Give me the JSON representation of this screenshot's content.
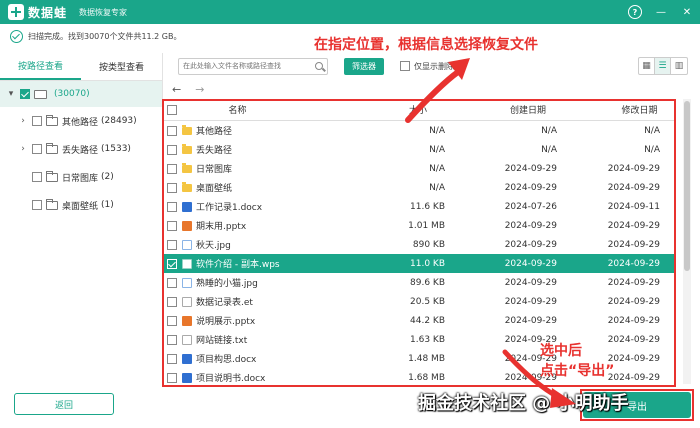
{
  "app": {
    "name": "数据蛙",
    "subtitle": "数据恢复专家",
    "help_symbol": "?",
    "minimize_symbol": "—",
    "close_symbol": "✕"
  },
  "status": {
    "text": "扫描完成。找到30070个文件共11.2 GB。"
  },
  "annotations": {
    "top": "在指定位置，根据信息选择恢复文件",
    "bottom_line1": "选中后",
    "bottom_line2": "点击“导出”"
  },
  "sidebar": {
    "tabs": [
      {
        "label": "按路径查看"
      },
      {
        "label": "按类型查看"
      }
    ],
    "root": {
      "count": "(30070)"
    },
    "items": [
      {
        "label": "其他路径",
        "count": "(28493)",
        "expandable": true
      },
      {
        "label": "丢失路径",
        "count": "(1533)",
        "expandable": true
      },
      {
        "label": "日常图库",
        "count": "(2)",
        "expandable": false
      },
      {
        "label": "桌面壁纸",
        "count": "(1)",
        "expandable": false
      }
    ]
  },
  "toolbar": {
    "search_placeholder": "在此处输入文件名称或路径查找",
    "filter_label": "筛选器",
    "deleted_only_label": "仅显示删除项",
    "view_icons": [
      "▦",
      "☰",
      "▥"
    ]
  },
  "nav": {
    "back": "←",
    "forward": "→"
  },
  "table": {
    "headers": {
      "name": "名称",
      "size": "大小",
      "created": "创建日期",
      "modified": "修改日期"
    },
    "rows": [
      {
        "name": "其他路径",
        "size": "N/A",
        "created": "N/A",
        "modified": "N/A",
        "icon": "folder",
        "selected": false
      },
      {
        "name": "丢失路径",
        "size": "N/A",
        "created": "N/A",
        "modified": "N/A",
        "icon": "folder",
        "selected": false
      },
      {
        "name": "日常图库",
        "size": "N/A",
        "created": "2024-09-29",
        "modified": "2024-09-29",
        "icon": "folder",
        "selected": false
      },
      {
        "name": "桌面壁纸",
        "size": "N/A",
        "created": "2024-09-29",
        "modified": "2024-09-29",
        "icon": "folder",
        "selected": false
      },
      {
        "name": "工作记录1.docx",
        "size": "11.6 KB",
        "created": "2024-07-26",
        "modified": "2024-09-11",
        "icon": "doc",
        "selected": false
      },
      {
        "name": "期末用.pptx",
        "size": "1.01 MB",
        "created": "2024-09-29",
        "modified": "2024-09-29",
        "icon": "ppt",
        "selected": false
      },
      {
        "name": "秋天.jpg",
        "size": "890 KB",
        "created": "2024-09-29",
        "modified": "2024-09-29",
        "icon": "img",
        "selected": false
      },
      {
        "name": "软件介绍 - 副本.wps",
        "size": "11.0 KB",
        "created": "2024-09-29",
        "modified": "2024-09-29",
        "icon": "wps",
        "selected": true
      },
      {
        "name": "熟睡的小猫.jpg",
        "size": "89.6 KB",
        "created": "2024-09-29",
        "modified": "2024-09-29",
        "icon": "img",
        "selected": false
      },
      {
        "name": "数据记录表.et",
        "size": "20.5 KB",
        "created": "2024-09-29",
        "modified": "2024-09-29",
        "icon": "et",
        "selected": false
      },
      {
        "name": "说明展示.pptx",
        "size": "44.2 KB",
        "created": "2024-09-29",
        "modified": "2024-09-29",
        "icon": "ppt",
        "selected": false
      },
      {
        "name": "网站链接.txt",
        "size": "1.63 KB",
        "created": "2024-09-29",
        "modified": "2024-09-29",
        "icon": "txt",
        "selected": false
      },
      {
        "name": "项目构思.docx",
        "size": "1.48 MB",
        "created": "2024-09-29",
        "modified": "2024-09-29",
        "icon": "doc",
        "selected": false
      },
      {
        "name": "项目说明书.docx",
        "size": "1.68 MB",
        "created": "2024-09-29",
        "modified": "2024-09-29",
        "icon": "doc",
        "selected": false
      }
    ]
  },
  "footer": {
    "back_label": "返回",
    "export_label": "导出",
    "watermark": "掘金技术社区 @ 小明助手"
  },
  "colors": {
    "brand": "#1aa68a",
    "annotation": "#e8322f",
    "selected_row": "#1aa68a"
  }
}
